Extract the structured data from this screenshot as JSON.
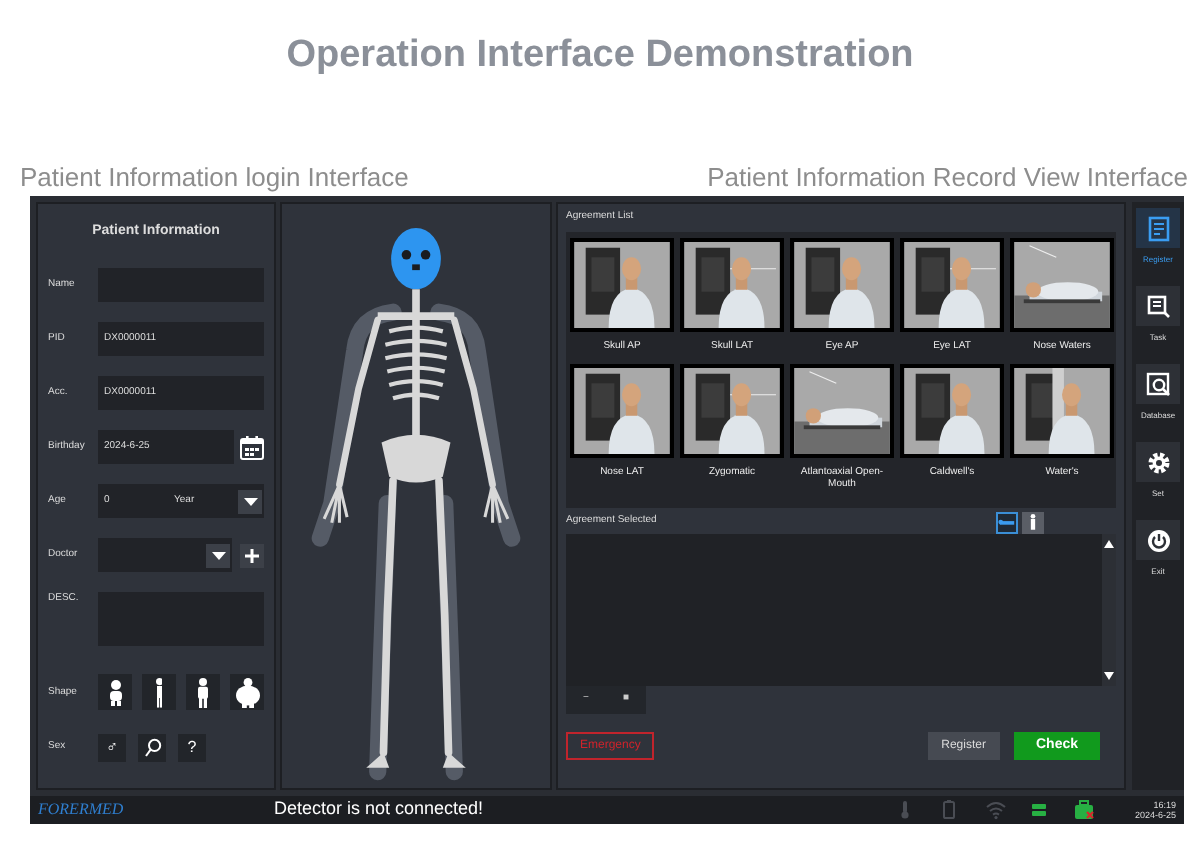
{
  "title": "Operation Interface Demonstration",
  "captions": [
    "Patient Information login Interface",
    "Patient Information Record View Interface"
  ],
  "patient_form": {
    "heading": "Patient Information",
    "fields": [
      {
        "kind": "text",
        "label": "Name"
      },
      {
        "kind": "text",
        "label": "PID",
        "value": "DX0000011"
      },
      {
        "kind": "text",
        "label": "Acc.",
        "value": "DX0000011"
      },
      {
        "kind": "date",
        "label": "Birthday",
        "value": "2024-6-25"
      },
      {
        "kind": "age",
        "label": "Age",
        "value": "0",
        "unit": "Year"
      },
      {
        "kind": "select",
        "label": "Doctor"
      },
      {
        "kind": "textarea",
        "label": "DESC."
      }
    ],
    "shape": {
      "label": "Shape",
      "options": [
        {
          "kind": "child"
        },
        {
          "kind": "slim"
        },
        {
          "kind": "medium"
        },
        {
          "kind": "large"
        }
      ]
    },
    "sex": {
      "label": "Sex",
      "options": [
        {
          "kind": "text",
          "text": "♂"
        },
        {
          "kind": "icon"
        },
        {
          "kind": "text",
          "text": "?"
        }
      ]
    }
  },
  "agreement_list": {
    "title": "Agreement List",
    "items": [
      {
        "label": "Skull AP"
      },
      {
        "label": "Skull LAT"
      },
      {
        "label": "Eye AP"
      },
      {
        "label": "Eye LAT"
      },
      {
        "label": "Nose Waters"
      },
      {
        "label": "Nose LAT"
      },
      {
        "label": "Zygomatic"
      },
      {
        "label": "Atlantoaxial Open-Mouth"
      },
      {
        "label": "Caldwell's"
      },
      {
        "label": "Water's"
      }
    ]
  },
  "agreement_selected": {
    "title": "Agreement Selected",
    "view_toggle": [
      {
        "kind": "lying",
        "selected": true
      },
      {
        "kind": "standing",
        "selected": false
      }
    ],
    "list_buttons": [
      "−",
      "■"
    ]
  },
  "actions": [
    {
      "kind": "emergency",
      "label": "Emergency"
    },
    {
      "kind": "secondary",
      "label": "Register"
    },
    {
      "kind": "primary",
      "label": "Check"
    }
  ],
  "sidebar": [
    {
      "kind": "register",
      "label": "Register",
      "selected": true
    },
    {
      "kind": "task",
      "label": "Task",
      "selected": false
    },
    {
      "kind": "database",
      "label": "Database",
      "selected": false
    },
    {
      "kind": "gear",
      "label": "Set",
      "selected": false
    },
    {
      "kind": "power",
      "label": "Exit",
      "selected": false
    }
  ],
  "status_bar": {
    "logo": "FORERMED",
    "message": "Detector is not connected!",
    "indicators": [
      {
        "kind": "thermometer",
        "on": false
      },
      {
        "kind": "battery",
        "on": false
      },
      {
        "kind": "wifi",
        "on": false
      },
      {
        "kind": "disk",
        "on": true
      },
      {
        "kind": "medkit",
        "on": true
      }
    ],
    "time": "16:19",
    "date": "2024-6-25"
  }
}
